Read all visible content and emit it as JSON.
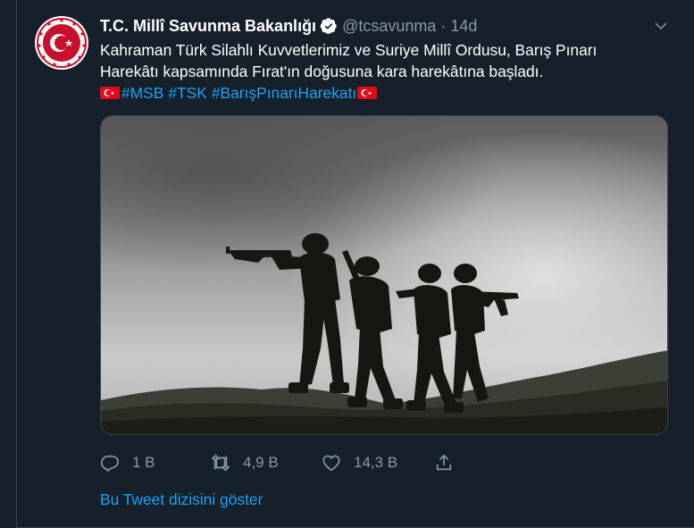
{
  "tweet": {
    "author_name": "T.C. Millî Savunma Bakanlığı",
    "handle": "@tcsavunma",
    "separator": "·",
    "time": "14d",
    "verified": true,
    "text_line1": "Kahraman Türk Silahlı Kuvvetlerimiz ve Suriye Millî Ordusu, Barış Pınarı",
    "text_line2": "Harekâtı kapsamında Fırat'ın doğusuna kara harekâtına başladı.",
    "hashtags": [
      "#MSB",
      "#TSK",
      "#BarışPınarıHarekatı"
    ],
    "icons": {
      "flag": "turkish-flag-emoji",
      "verified": "verified-badge-icon",
      "caret": "chevron-down-icon"
    }
  },
  "actions": {
    "reply_count": "1 B",
    "retweet_count": "4,9 B",
    "like_count": "14,3 B"
  },
  "show_thread": "Bu Tweet dizisini göster",
  "colors": {
    "background": "#15202b",
    "accent": "#1da1f2",
    "muted": "#8899a6",
    "flag_red": "#e30a17"
  }
}
